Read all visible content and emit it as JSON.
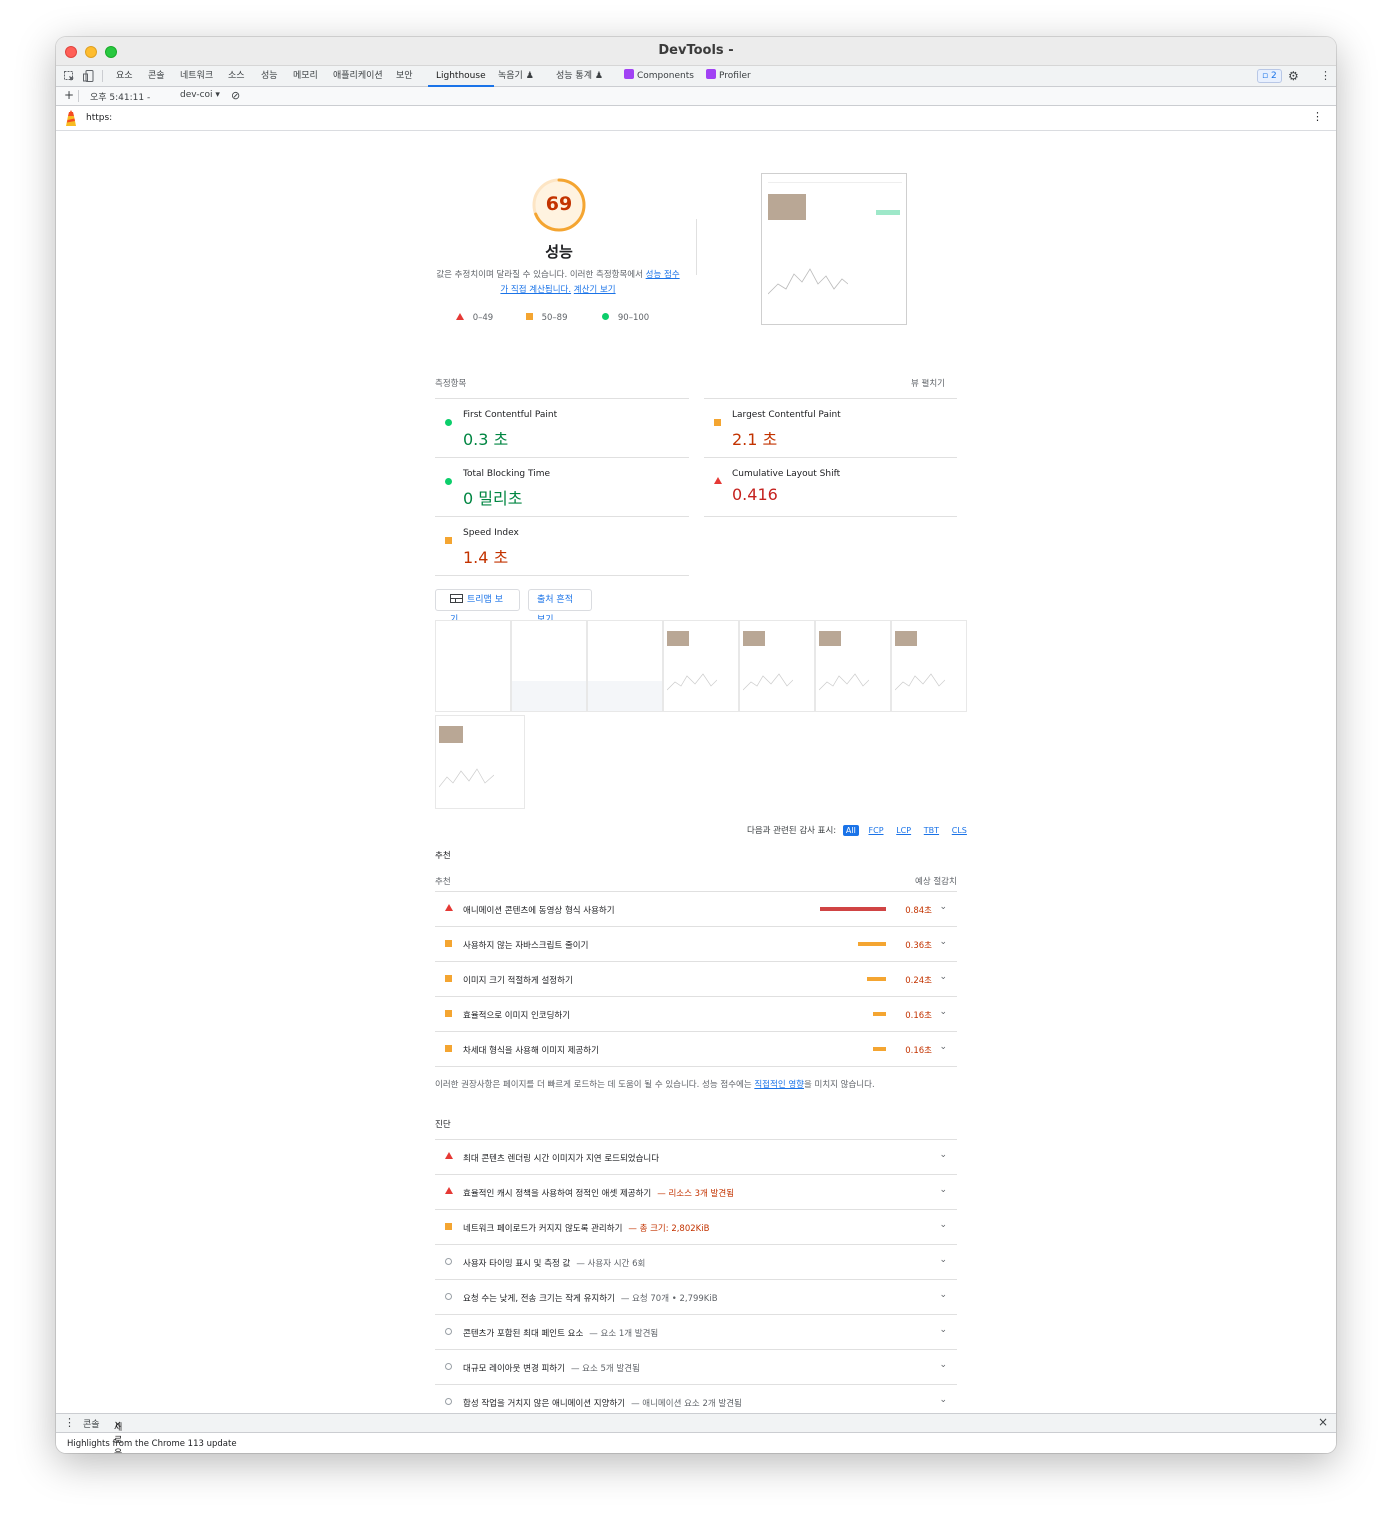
{
  "window": {
    "title": "DevTools -"
  },
  "tabs": [
    {
      "label": "요소"
    },
    {
      "label": "콘솔"
    },
    {
      "label": "네트워크"
    },
    {
      "label": "소스"
    },
    {
      "label": "성능"
    },
    {
      "label": "메모리"
    },
    {
      "label": "애플리케이션"
    },
    {
      "label": "보안"
    },
    {
      "label": "Lighthouse"
    },
    {
      "label": "녹음기 ♟"
    },
    {
      "label": "성능 통계 ♟"
    },
    {
      "label": "Components"
    },
    {
      "label": "Profiler"
    }
  ],
  "issues_count": "2",
  "toolbar2": {
    "time": "오후 5:41:11 -",
    "target": "dev-coi ▾"
  },
  "url": {
    "text": "https:"
  },
  "gauge": {
    "score": "69",
    "title": "성능"
  },
  "description": {
    "text": "값은 추정치이며 달라질 수 있습니다. 이러한 측정항목에서 ",
    "link1": "성능 점수가 직접 계산됩니다.",
    "link2": "계산기 보기"
  },
  "legend": {
    "fail": "0–49",
    "average": "50–89",
    "pass": "90–100"
  },
  "metrics_section": {
    "label": "측정항목",
    "expand": "뷰 펼치기"
  },
  "metrics": [
    {
      "name": "First Contentful Paint",
      "value": "0.3 초",
      "status": "pass"
    },
    {
      "name": "Largest Contentful Paint",
      "value": "2.1 초",
      "status": "average"
    },
    {
      "name": "Total Blocking Time",
      "value": "0 밀리초",
      "status": "pass"
    },
    {
      "name": "Cumulative Layout Shift",
      "value": "0.416",
      "status": "fail"
    },
    {
      "name": "Speed Index",
      "value": "1.4 초",
      "status": "average"
    }
  ],
  "buttons": {
    "treemap": "트리맵 보기",
    "trace": "출처 흔적 보기"
  },
  "audit_filter": {
    "label": "다음과 관련된 감사 표시:",
    "options": [
      "All",
      "FCP",
      "LCP",
      "TBT",
      "CLS"
    ]
  },
  "opportunities": {
    "section": "추천",
    "col_left": "추천",
    "col_right": "예상 절감치",
    "items": [
      {
        "title": "애니메이션 콘텐츠에 동영상 형식 사용하기",
        "savings": "0.84초",
        "status": "fail",
        "fraction": 1.0
      },
      {
        "title": "사용하지 않는 자바스크립트 줄이기",
        "savings": "0.36초",
        "status": "average",
        "fraction": 0.43
      },
      {
        "title": "이미지 크기 적절하게 설정하기",
        "savings": "0.24초",
        "status": "average",
        "fraction": 0.29
      },
      {
        "title": "효율적으로 이미지 인코딩하기",
        "savings": "0.16초",
        "status": "average",
        "fraction": 0.19
      },
      {
        "title": "차세대 형식을 사용해 이미지 제공하기",
        "savings": "0.16초",
        "status": "average",
        "fraction": 0.19
      }
    ],
    "footnote": "이러한 권장사항은 페이지를 더 빠르게 로드하는 데 도움이 될 수 있습니다. 성능 점수에는 ",
    "footnote_link": "직접적인 영향",
    "footnote_end": "을 미치지 않습니다."
  },
  "diagnostics": {
    "section": "진단",
    "items": [
      {
        "title": "최대 콘텐츠 렌더링 시간 이미지가 지연 로드되었습니다",
        "detail": "",
        "status": "fail"
      },
      {
        "title": "효율적인 캐시 정책을 사용하여 정적인 애셋 제공하기",
        "detail": "— 리소스 3개 발견됨",
        "status": "fail"
      },
      {
        "title": "네트워크 페이로드가 커지지 않도록 관리하기",
        "detail": "— 총 크기: 2,802KiB",
        "status": "average"
      },
      {
        "title": "사용자 타이밍 표시 및 측정 값",
        "detail": "— 사용자 시간 6회",
        "status": "info"
      },
      {
        "title": "요청 수는 낮게, 전송 크기는 작게 유지하기",
        "detail": "— 요청 70개 • 2,799KiB",
        "status": "info"
      },
      {
        "title": "콘텐츠가 포함된 최대 페인트 요소",
        "detail": "— 요소 1개 발견됨",
        "status": "info"
      },
      {
        "title": "대규모 레이아웃 변경 피하기",
        "detail": "— 요소 5개 발견됨",
        "status": "info"
      },
      {
        "title": "합성 작업을 거치지 않은 애니메이션 지양하기",
        "detail": "— 애니메이션 요소 2개 발견됨",
        "status": "info"
      }
    ]
  },
  "drawer": {
    "tab1": "콘솔",
    "tab2": "새로운 기능",
    "highlight": "Highlights from the Chrome 113 update"
  },
  "colors": {
    "fail": "#e53935",
    "average": "#f4a531",
    "pass": "#0cce6b",
    "accent": "#1a73e8"
  }
}
